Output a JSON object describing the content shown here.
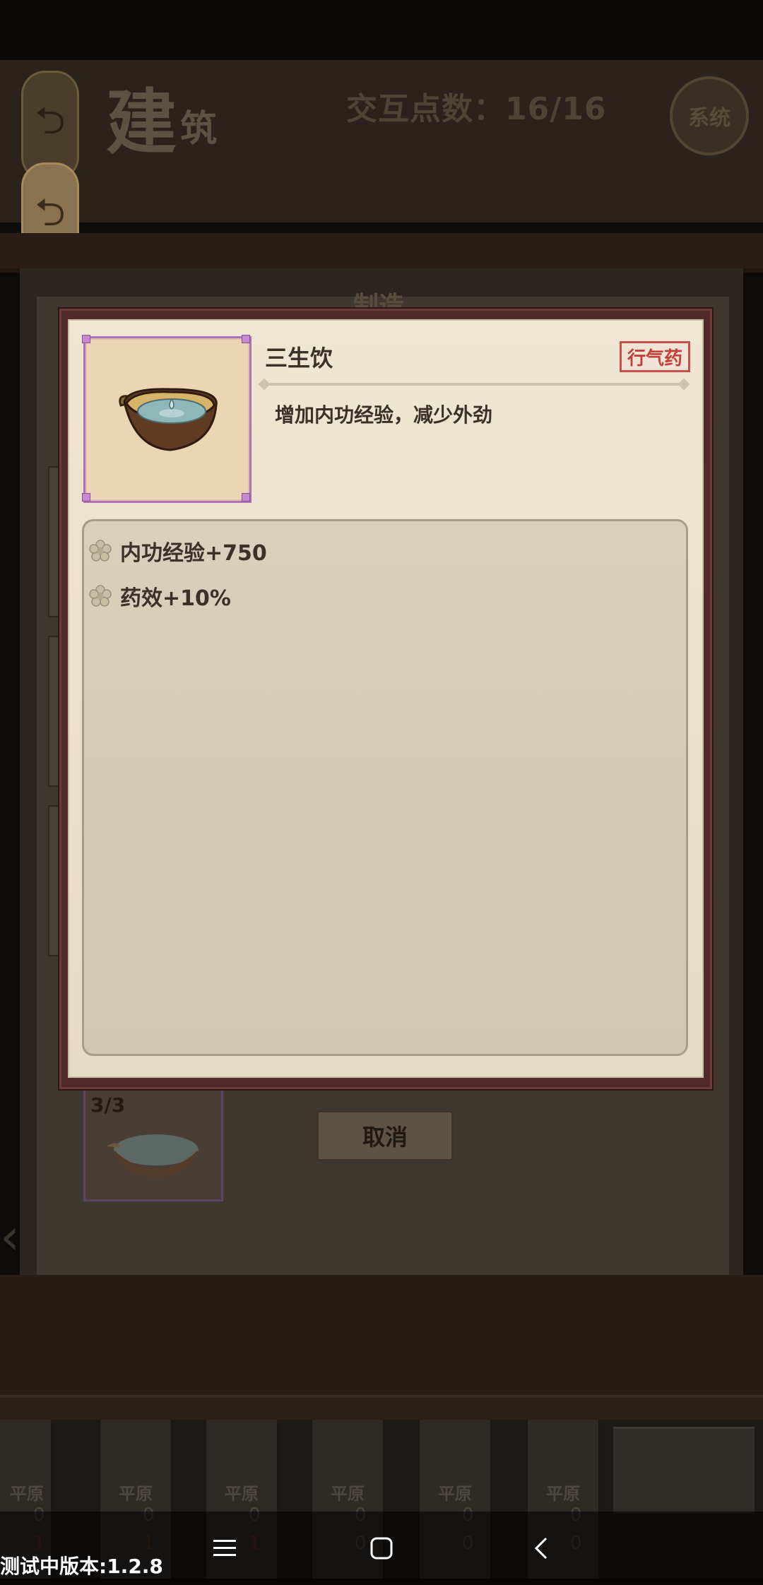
{
  "header": {
    "title_char1": "建",
    "title_char2": "筑",
    "interaction_points": "交互点数：16/16",
    "system_button": "系统"
  },
  "board": {
    "heading": "制造",
    "slot_count": "3/3",
    "cancel_label": "取消"
  },
  "modal": {
    "item_name": "三生饮",
    "item_tag": "行气药",
    "item_description": "增加内功经验，减少外劲",
    "effects": [
      {
        "text": "内功经验+750"
      },
      {
        "text": "药效+10%"
      }
    ]
  },
  "bottom_tiles": [
    {
      "label": "平原",
      "value1": "0",
      "value2": "1"
    },
    {
      "label": "平原",
      "value1": "0",
      "value2": "1"
    },
    {
      "label": "平原",
      "value1": "0",
      "value2": "1"
    },
    {
      "label": "平原",
      "value1": "0",
      "value2": "0"
    },
    {
      "label": "平原",
      "value1": "0",
      "value2": "0"
    },
    {
      "label": "平原",
      "value1": "0",
      "value2": "0"
    }
  ],
  "version_text": "测试中版本:1.2.8",
  "colors": {
    "tag_red": "#c4403b",
    "item_frame_purple": "#b06fb6",
    "panel_bg": "#efe6d3",
    "modal_border": "#4f2a28"
  },
  "icons": {
    "back": "back-arrow-icon",
    "effect": "flower-icon",
    "bowl": "tea-bowl-icon",
    "nav_menu": "menu-icon",
    "nav_home": "home-icon",
    "nav_back": "chevron-left-icon"
  }
}
